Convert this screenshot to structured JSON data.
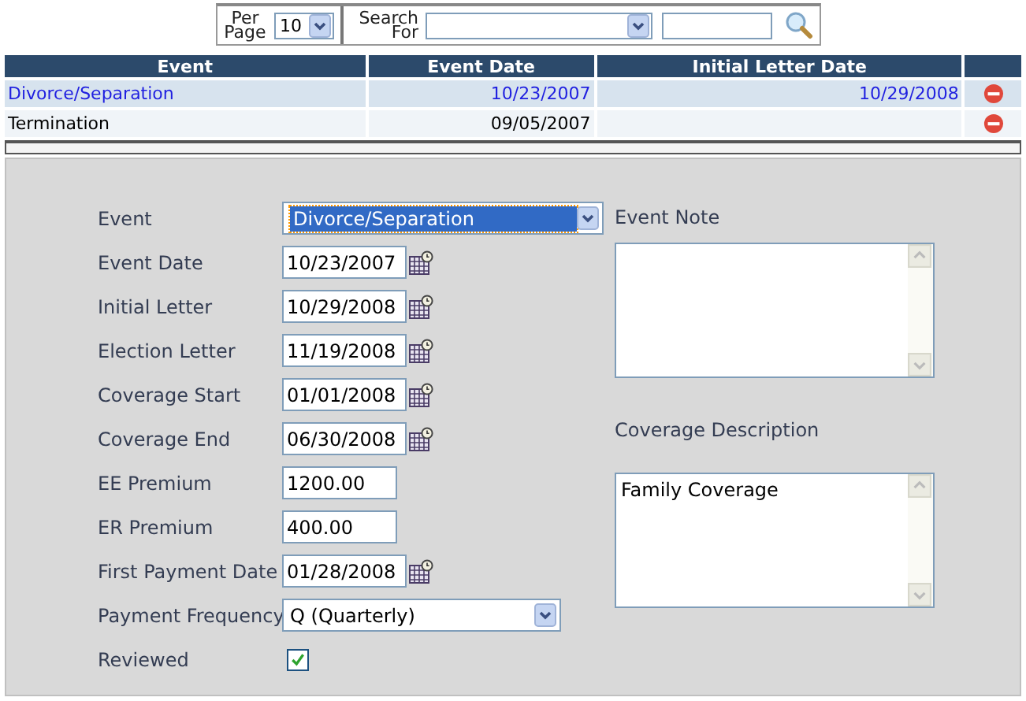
{
  "toolbar": {
    "per_page_label": "Per Page",
    "per_page_value": "10",
    "search_label": "Search For"
  },
  "table": {
    "columns": [
      "Event",
      "Event Date",
      "Initial Letter Date"
    ],
    "rows": [
      {
        "event": "Divorce/Separation",
        "event_date": "10/23/2007",
        "initial_letter_date": "10/29/2008",
        "selected": true
      },
      {
        "event": "Termination",
        "event_date": "09/05/2007",
        "selected": false
      }
    ]
  },
  "form": {
    "fields": [
      {
        "label": "Event",
        "kind": "select",
        "value": "Divorce/Separation",
        "focused": true
      },
      {
        "label": "Event Date",
        "kind": "date",
        "value": "10/23/2007"
      },
      {
        "label": "Initial Letter",
        "kind": "date",
        "value": "10/29/2008"
      },
      {
        "label": "Election Letter",
        "kind": "date",
        "value": "11/19/2008"
      },
      {
        "label": "Coverage Start",
        "kind": "date",
        "value": "01/01/2008"
      },
      {
        "label": "Coverage End",
        "kind": "date",
        "value": "06/30/2008"
      },
      {
        "label": "EE Premium",
        "kind": "text",
        "value": "1200.00"
      },
      {
        "label": "ER Premium",
        "kind": "text",
        "value": "400.00"
      },
      {
        "label": "First Payment Date",
        "kind": "date",
        "value": "01/28/2008"
      },
      {
        "label": "Payment Frequency",
        "kind": "select",
        "value": "Q (Quarterly)",
        "focused": false
      },
      {
        "label": "Reviewed",
        "kind": "checkbox",
        "checked": true
      }
    ],
    "notes": [
      {
        "label": "Event Note"
      },
      {
        "label": "Coverage Description",
        "value": "Family Coverage"
      }
    ]
  }
}
